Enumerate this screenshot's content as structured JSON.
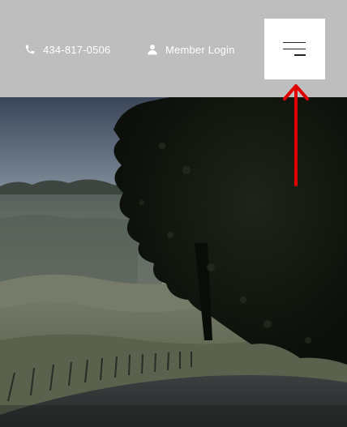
{
  "header": {
    "phone_text": "434-817-0506",
    "member_login_text": "Member Login",
    "phone_icon": "phone-icon",
    "user_icon": "user-icon",
    "menu_icon": "hamburger-menu-icon"
  },
  "hero": {
    "scene": "golf-course-landscape-photo"
  },
  "colors": {
    "header_bg": "#bebebe",
    "menu_button_bg": "#ffffff",
    "annotation_arrow": "#e00000"
  }
}
